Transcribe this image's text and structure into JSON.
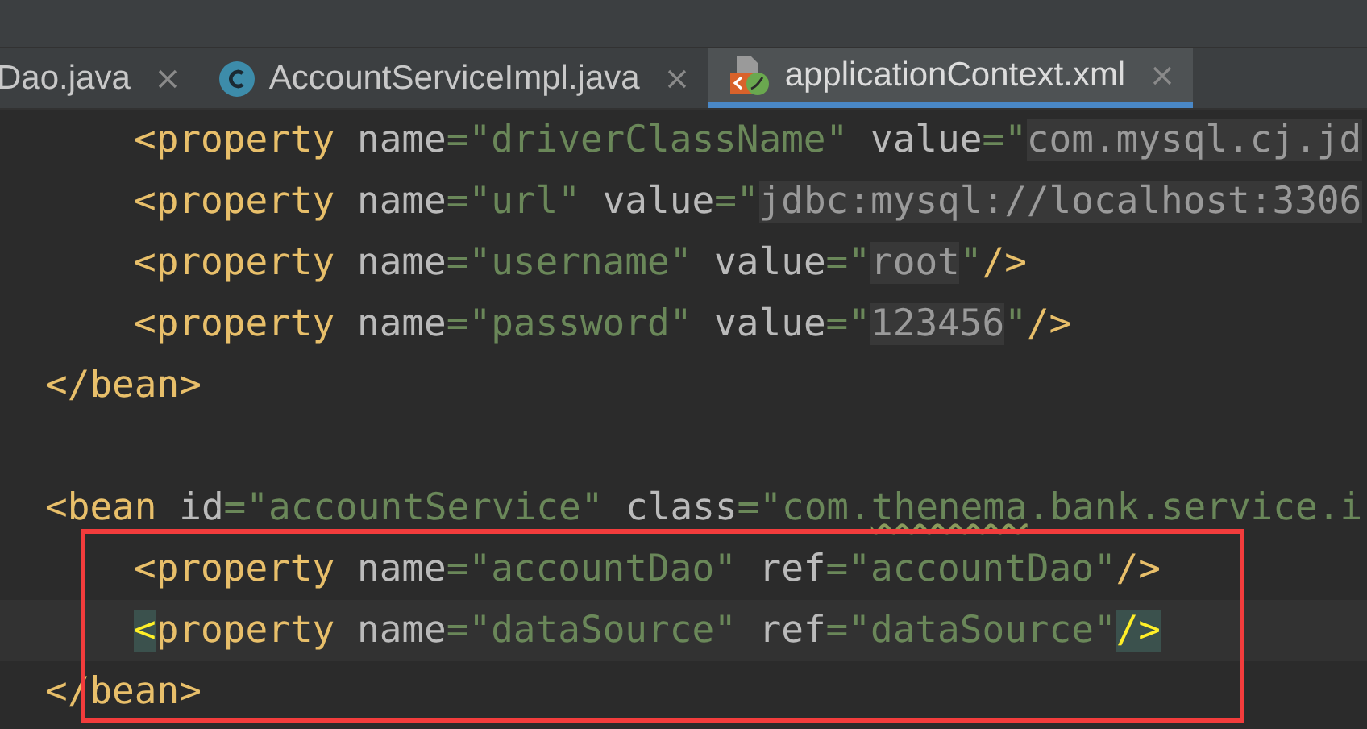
{
  "tabs": [
    {
      "label": "Dao.java",
      "selected": false
    },
    {
      "label": "AccountServiceImpl.java",
      "selected": false
    },
    {
      "label": "applicationContext.xml",
      "selected": true
    }
  ],
  "code_lines": [
    {
      "kind": "nested",
      "segments": [
        {
          "kind": "tag",
          "text": "<property"
        },
        {
          "kind": "attr",
          "text": " name"
        },
        {
          "kind": "value",
          "text": "=\"driverClassName\""
        },
        {
          "kind": "attr",
          "text": " value"
        },
        {
          "kind": "value",
          "text": "=\""
        },
        {
          "kind": "injected",
          "text": "com.mysql.cj.jd"
        }
      ]
    },
    {
      "kind": "nested",
      "segments": [
        {
          "kind": "tag",
          "text": "<property"
        },
        {
          "kind": "attr",
          "text": " name"
        },
        {
          "kind": "value",
          "text": "=\"url\""
        },
        {
          "kind": "attr",
          "text": " value"
        },
        {
          "kind": "value",
          "text": "=\""
        },
        {
          "kind": "injected",
          "text": "jdbc:mysql://localhost:3306"
        }
      ]
    },
    {
      "kind": "nested",
      "segments": [
        {
          "kind": "tag",
          "text": "<property"
        },
        {
          "kind": "attr",
          "text": " name"
        },
        {
          "kind": "value",
          "text": "=\"username\""
        },
        {
          "kind": "attr",
          "text": " value"
        },
        {
          "kind": "value",
          "text": "=\""
        },
        {
          "kind": "injected",
          "text": "root"
        },
        {
          "kind": "value",
          "text": "\""
        },
        {
          "kind": "tag",
          "text": "/>"
        }
      ]
    },
    {
      "kind": "nested",
      "segments": [
        {
          "kind": "tag",
          "text": "<property"
        },
        {
          "kind": "attr",
          "text": " name"
        },
        {
          "kind": "value",
          "text": "=\"password\""
        },
        {
          "kind": "attr",
          "text": " value"
        },
        {
          "kind": "value",
          "text": "=\""
        },
        {
          "kind": "injected",
          "text": "123456"
        },
        {
          "kind": "value",
          "text": "\""
        },
        {
          "kind": "tag",
          "text": "/>"
        }
      ]
    },
    {
      "kind": "top",
      "segments": [
        {
          "kind": "tag",
          "text": "</bean>"
        }
      ]
    },
    {
      "kind": "blank"
    },
    {
      "kind": "top",
      "segments": [
        {
          "kind": "tag",
          "text": "<bean"
        },
        {
          "kind": "attr",
          "text": " id"
        },
        {
          "kind": "value",
          "text": "=\"accountService\""
        },
        {
          "kind": "attr",
          "text": " class"
        },
        {
          "kind": "value",
          "text": "=\"com."
        },
        {
          "kind": "typo",
          "text": "thenema"
        },
        {
          "kind": "value",
          "text": ".bank.service.i"
        }
      ]
    },
    {
      "kind": "nested",
      "segments": [
        {
          "kind": "tag",
          "text": "<property"
        },
        {
          "kind": "attr",
          "text": " name"
        },
        {
          "kind": "value",
          "text": "=\"accountDao\""
        },
        {
          "kind": "attr",
          "text": " ref"
        },
        {
          "kind": "value",
          "text": "=\"accountDao\""
        },
        {
          "kind": "tag",
          "text": "/>"
        }
      ]
    },
    {
      "kind": "nested",
      "current": true,
      "segments": [
        {
          "kind": "match",
          "text": "<"
        },
        {
          "kind": "tag",
          "text": "property"
        },
        {
          "kind": "attr",
          "text": " name"
        },
        {
          "kind": "value",
          "text": "=\"dataSource\""
        },
        {
          "kind": "attr",
          "text": " ref"
        },
        {
          "kind": "value",
          "text": "=\"dataSource\""
        },
        {
          "kind": "match",
          "text": "/>"
        }
      ]
    },
    {
      "kind": "top",
      "segments": [
        {
          "kind": "tag",
          "text": "</bean>"
        }
      ]
    }
  ]
}
